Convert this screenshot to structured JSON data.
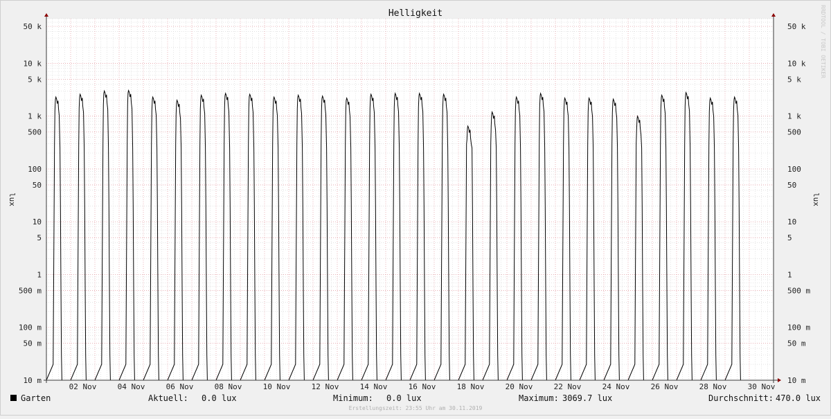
{
  "chart_data": {
    "type": "line",
    "title": "Helligkeit",
    "ylabel": "lux",
    "yscale": "log",
    "ylim": [
      0.01,
      70000
    ],
    "xlim": [
      "2019-11-01T00:00",
      "2019-11-31T00:00"
    ],
    "y_ticks": [
      {
        "value": 50000,
        "label": "50 k"
      },
      {
        "value": 10000,
        "label": "10 k"
      },
      {
        "value": 5000,
        "label": "5 k"
      },
      {
        "value": 1000,
        "label": "1 k"
      },
      {
        "value": 500,
        "label": "500"
      },
      {
        "value": 100,
        "label": "100"
      },
      {
        "value": 50,
        "label": "50"
      },
      {
        "value": 10,
        "label": "10"
      },
      {
        "value": 5,
        "label": "5"
      },
      {
        "value": 1,
        "label": "1"
      },
      {
        "value": 0.5,
        "label": "500 m"
      },
      {
        "value": 0.1,
        "label": "100 m"
      },
      {
        "value": 0.05,
        "label": "50 m"
      },
      {
        "value": 0.01,
        "label": "10 m"
      }
    ],
    "x_ticks": [
      {
        "day": 2,
        "label": "02 Nov"
      },
      {
        "day": 4,
        "label": "04 Nov"
      },
      {
        "day": 6,
        "label": "06 Nov"
      },
      {
        "day": 8,
        "label": "08 Nov"
      },
      {
        "day": 10,
        "label": "10 Nov"
      },
      {
        "day": 12,
        "label": "12 Nov"
      },
      {
        "day": 14,
        "label": "14 Nov"
      },
      {
        "day": 16,
        "label": "16 Nov"
      },
      {
        "day": 18,
        "label": "18 Nov"
      },
      {
        "day": 20,
        "label": "20 Nov"
      },
      {
        "day": 22,
        "label": "22 Nov"
      },
      {
        "day": 24,
        "label": "24 Nov"
      },
      {
        "day": 26,
        "label": "26 Nov"
      },
      {
        "day": 28,
        "label": "28 Nov"
      },
      {
        "day": 30,
        "label": "30 Nov"
      }
    ],
    "grid": true,
    "series": [
      {
        "name": "Garten",
        "color": "#000000",
        "daily_peak_lux": [
          2300,
          2600,
          3000,
          3070,
          2300,
          2000,
          2500,
          2700,
          2600,
          2300,
          2500,
          2400,
          2200,
          2600,
          2700,
          2700,
          2600,
          650,
          1200,
          2300,
          2700,
          2200,
          2200,
          2100,
          1000,
          2500,
          2800,
          2200,
          2300
        ],
        "stats": {
          "Aktuell": "0.0 lux",
          "Minimum": "0.0 lux",
          "Maximum": "3069.7 lux",
          "Durchschnitt": "470.0 lux"
        }
      }
    ]
  },
  "legend": {
    "label": "Garten",
    "current_label": "Aktuell:",
    "current_value": "0.0 lux",
    "min_label": "Minimum:",
    "min_value": "0.0 lux",
    "max_label": "Maximum:",
    "max_value": "3069.7 lux",
    "avg_label": "Durchschnitt:",
    "avg_value": "470.0 lux"
  },
  "footer": "Erstellungszeit: 23:55 Uhr am 30.11.2019",
  "watermark": "RRDTOOL / TOBI OETIKER",
  "colors": {
    "background": "#f0f0f0",
    "plot": "#ffffff",
    "grid_major": "#e7a1a8",
    "grid_minor": "#d2d2d2",
    "axis": "#3a3a3a",
    "arrow": "#8b0000"
  }
}
